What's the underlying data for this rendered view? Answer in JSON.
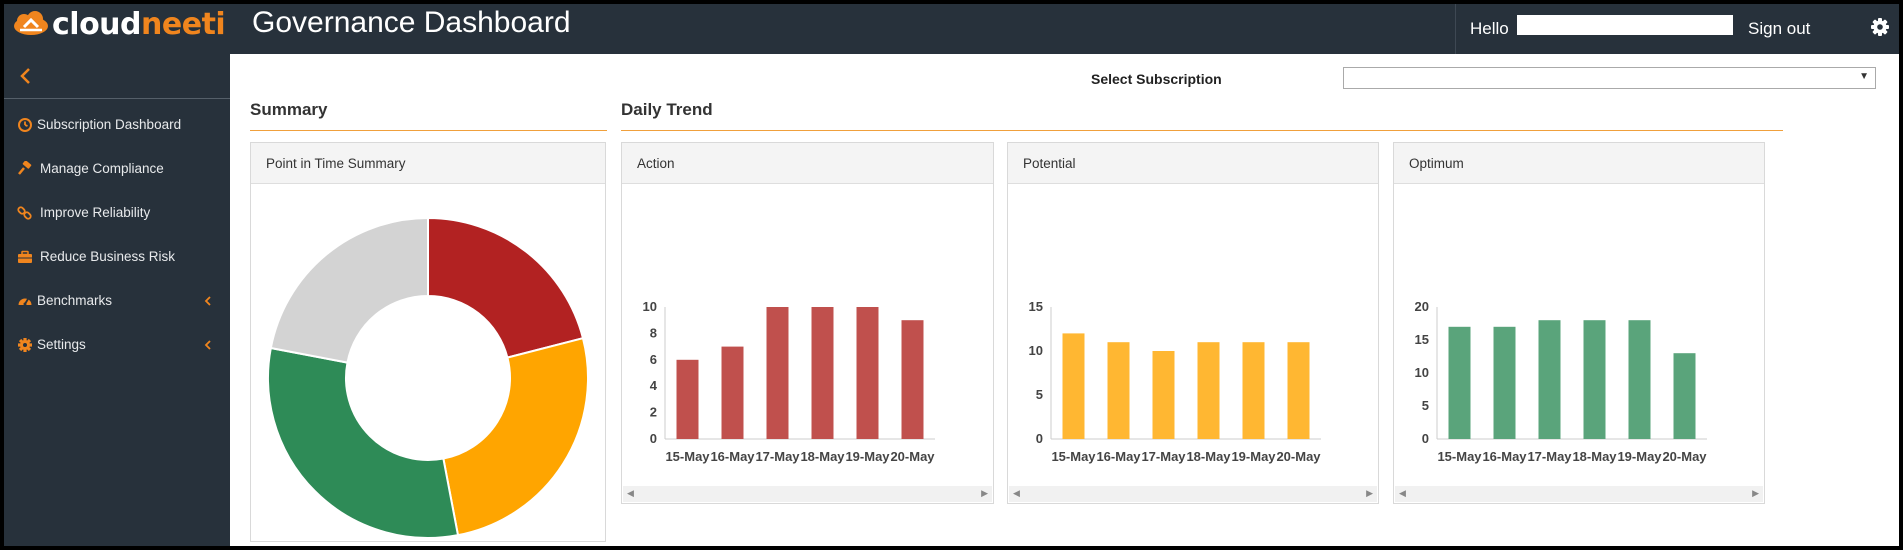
{
  "header": {
    "logo_part1": "cloud",
    "logo_part2": "neeti",
    "title": "Governance Dashboard",
    "greeting": "Hello",
    "signout_label": "Sign out"
  },
  "sidebar": {
    "items": [
      {
        "label": "Subscription Dashboard",
        "icon": "dashboard-icon",
        "has_submenu": false
      },
      {
        "label": "Manage Compliance",
        "icon": "gavel-icon",
        "has_submenu": false
      },
      {
        "label": "Improve Reliability",
        "icon": "link-icon",
        "has_submenu": false
      },
      {
        "label": "Reduce Business Risk",
        "icon": "briefcase-icon",
        "has_submenu": false
      },
      {
        "label": "Benchmarks",
        "icon": "tachometer-icon",
        "has_submenu": true
      },
      {
        "label": "Settings",
        "icon": "gear-icon",
        "has_submenu": true
      }
    ]
  },
  "subscription": {
    "label": "Select Subscription",
    "selected": ""
  },
  "summary": {
    "section_title": "Summary",
    "panel_title": "Point in Time Summary"
  },
  "trend": {
    "section_title": "Daily Trend"
  },
  "colors": {
    "accent": "#f0851e",
    "header_bg": "#27313b",
    "action": "#c0504d",
    "potential": "#ffb732",
    "optimum": "#5aa47b",
    "donut_red": "#b22222",
    "donut_orange": "#ffa500",
    "donut_green": "#2e8b57",
    "donut_gray": "#d3d3d3"
  },
  "chart_data": [
    {
      "type": "pie",
      "title": "Point in Time Summary",
      "donut": true,
      "values": [
        21,
        26,
        31,
        22
      ],
      "colors": [
        "#b22222",
        "#ffa500",
        "#2e8b57",
        "#d3d3d3"
      ]
    },
    {
      "type": "bar",
      "title": "Action",
      "categories": [
        "15-May",
        "16-May",
        "17-May",
        "18-May",
        "19-May",
        "20-May"
      ],
      "values": [
        6,
        7,
        10,
        10,
        10,
        9
      ],
      "ylim": [
        0,
        10
      ],
      "yticks": [
        0,
        2,
        4,
        6,
        8,
        10
      ],
      "color": "#c0504d"
    },
    {
      "type": "bar",
      "title": "Potential",
      "categories": [
        "15-May",
        "16-May",
        "17-May",
        "18-May",
        "19-May",
        "20-May"
      ],
      "values": [
        12,
        11,
        10,
        11,
        11,
        11
      ],
      "ylim": [
        0,
        15
      ],
      "yticks": [
        0,
        5,
        10,
        15
      ],
      "color": "#ffb732"
    },
    {
      "type": "bar",
      "title": "Optimum",
      "categories": [
        "15-May",
        "16-May",
        "17-May",
        "18-May",
        "19-May",
        "20-May"
      ],
      "values": [
        17,
        17,
        18,
        18,
        18,
        13
      ],
      "ylim": [
        0,
        20
      ],
      "yticks": [
        0,
        5,
        10,
        15,
        20
      ],
      "color": "#5aa47b"
    }
  ]
}
